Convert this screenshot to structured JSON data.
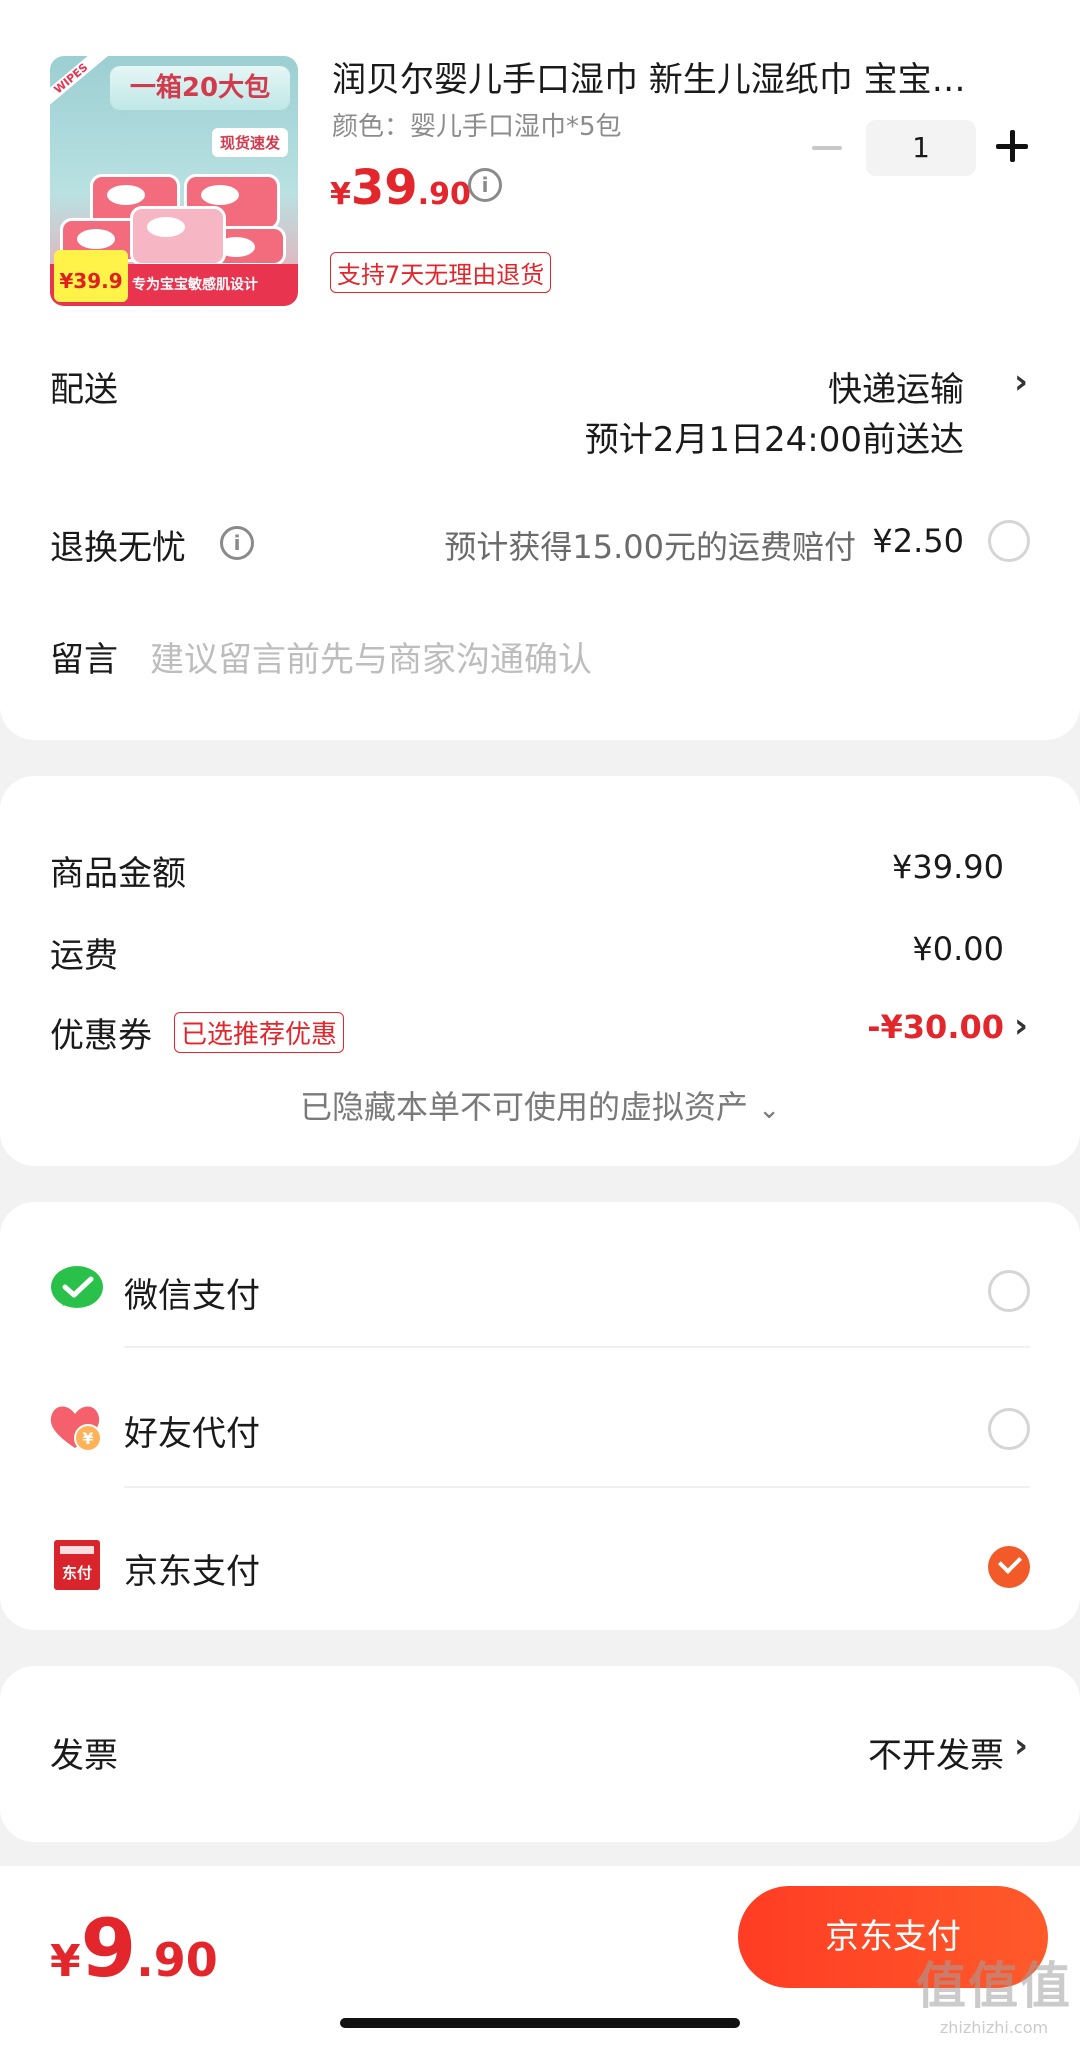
{
  "product": {
    "image_banner": "一箱20大包",
    "image_tag": "现货速发",
    "image_price": "¥39.9",
    "image_slogan": "专为宝宝敏感肌设计",
    "image_ribbon": "WIPES",
    "title": "润贝尔婴儿手口湿巾 新生儿湿纸巾 宝宝…",
    "spec": "颜色：婴儿手口湿巾*5包",
    "price_symbol": "¥",
    "price_int": "39",
    "price_dec": ".90",
    "quantity": "1",
    "return_badge": "支持7天无理由退货"
  },
  "delivery": {
    "label": "配送",
    "method": "快递运输",
    "estimate": "预计2月1日24:00前送达"
  },
  "return_insurance": {
    "label": "退换无忧",
    "desc": "预计获得15.00元的运费赔付",
    "price": "¥2.50"
  },
  "message": {
    "label": "留言",
    "placeholder": "建议留言前先与商家沟通确认"
  },
  "amounts": {
    "goods_label": "商品金额",
    "goods_value": "¥39.90",
    "shipping_label": "运费",
    "shipping_value": "¥0.00",
    "coupon_label": "优惠券",
    "coupon_badge": "已选推荐优惠",
    "coupon_value": "-¥30.00",
    "hidden_note": "已隐藏本单不可使用的虚拟资产"
  },
  "payment": {
    "options": [
      {
        "label": "微信支付",
        "icon": "wechat-pay-icon",
        "selected": false
      },
      {
        "label": "好友代付",
        "icon": "friend-pay-icon",
        "selected": false
      },
      {
        "label": "京东支付",
        "icon": "jd-pay-icon",
        "selected": true
      }
    ]
  },
  "invoice": {
    "label": "发票",
    "value": "不开发票"
  },
  "bottom": {
    "total_symbol": "¥",
    "total_int": "9",
    "total_dec": ".90",
    "pay_button": "京东支付",
    "watermark_big": "值值值",
    "watermark_small": "zhizhizhi.com"
  },
  "colors": {
    "accent": "#e3262b",
    "pay_button": "#ff4726",
    "wechat": "#29c14a"
  }
}
